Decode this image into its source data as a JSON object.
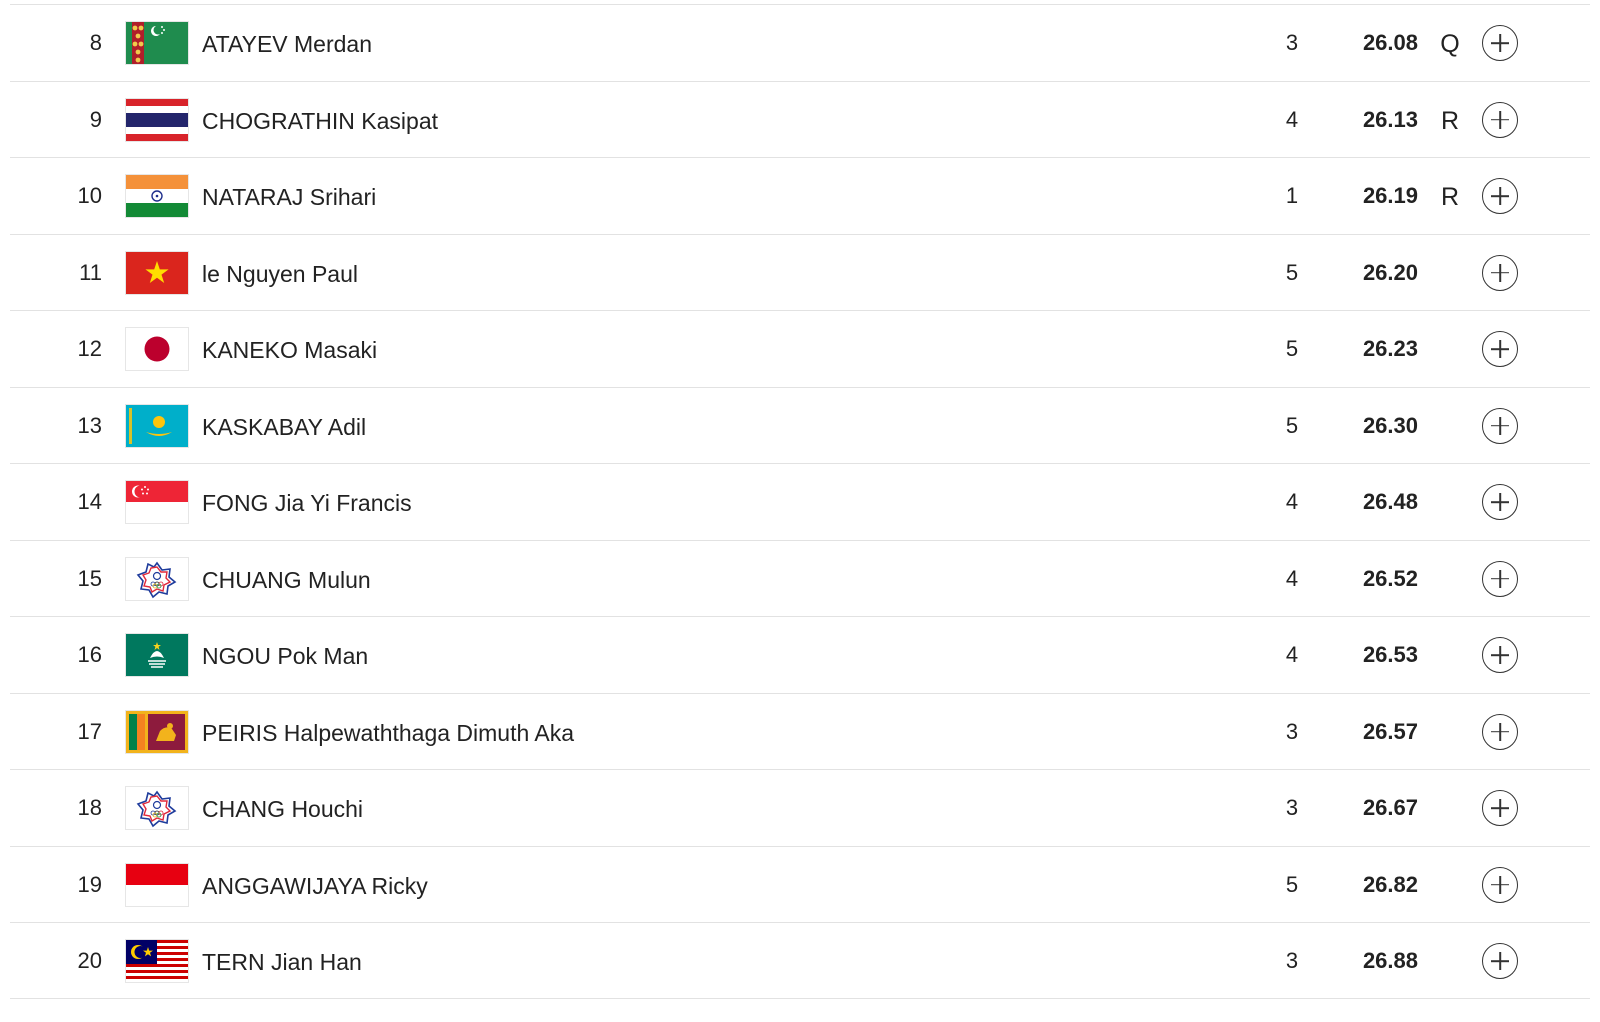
{
  "results": [
    {
      "rank": "8",
      "flag": "turkmenistan-flag",
      "athlete": "ATAYEV Merdan",
      "heat": "3",
      "time": "26.08",
      "qualifier": "Q",
      "expand_icon": "plus-circle-icon"
    },
    {
      "rank": "9",
      "flag": "thailand-flag",
      "athlete": "CHOGRATHIN Kasipat",
      "heat": "4",
      "time": "26.13",
      "qualifier": "R",
      "expand_icon": "plus-circle-icon"
    },
    {
      "rank": "10",
      "flag": "india-flag",
      "athlete": "NATARAJ Srihari",
      "heat": "1",
      "time": "26.19",
      "qualifier": "R",
      "expand_icon": "plus-circle-icon"
    },
    {
      "rank": "11",
      "flag": "vietnam-flag",
      "athlete": "le Nguyen Paul",
      "heat": "5",
      "time": "26.20",
      "qualifier": "",
      "expand_icon": "plus-circle-icon"
    },
    {
      "rank": "12",
      "flag": "japan-flag",
      "athlete": "KANEKO Masaki",
      "heat": "5",
      "time": "26.23",
      "qualifier": "",
      "expand_icon": "plus-circle-icon"
    },
    {
      "rank": "13",
      "flag": "kazakhstan-flag",
      "athlete": "KASKABAY Adil",
      "heat": "5",
      "time": "26.30",
      "qualifier": "",
      "expand_icon": "plus-circle-icon"
    },
    {
      "rank": "14",
      "flag": "singapore-flag",
      "athlete": "FONG Jia Yi Francis",
      "heat": "4",
      "time": "26.48",
      "qualifier": "",
      "expand_icon": "plus-circle-icon"
    },
    {
      "rank": "15",
      "flag": "chinese-taipei-flag",
      "athlete": "CHUANG Mulun",
      "heat": "4",
      "time": "26.52",
      "qualifier": "",
      "expand_icon": "plus-circle-icon"
    },
    {
      "rank": "16",
      "flag": "macau-flag",
      "athlete": "NGOU Pok Man",
      "heat": "4",
      "time": "26.53",
      "qualifier": "",
      "expand_icon": "plus-circle-icon"
    },
    {
      "rank": "17",
      "flag": "sri-lanka-flag",
      "athlete": "PEIRIS Halpewaththaga Dimuth Aka",
      "heat": "3",
      "time": "26.57",
      "qualifier": "",
      "expand_icon": "plus-circle-icon"
    },
    {
      "rank": "18",
      "flag": "chinese-taipei-flag",
      "athlete": "CHANG Houchi",
      "heat": "3",
      "time": "26.67",
      "qualifier": "",
      "expand_icon": "plus-circle-icon"
    },
    {
      "rank": "19",
      "flag": "indonesia-flag",
      "athlete": "ANGGAWIJAYA Ricky",
      "heat": "5",
      "time": "26.82",
      "qualifier": "",
      "expand_icon": "plus-circle-icon"
    },
    {
      "rank": "20",
      "flag": "malaysia-flag",
      "athlete": "TERN Jian Han",
      "heat": "3",
      "time": "26.88",
      "qualifier": "",
      "expand_icon": "plus-circle-icon"
    }
  ],
  "colors": {
    "divider": "#e2e2e2",
    "text": "#222222",
    "icon": "#333333"
  }
}
